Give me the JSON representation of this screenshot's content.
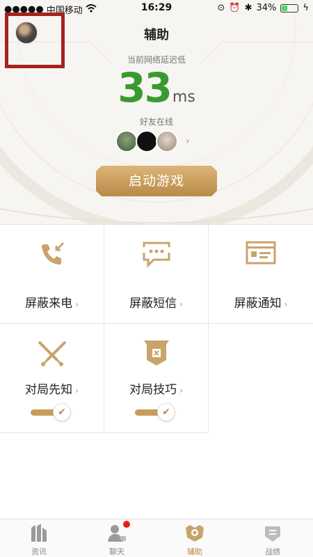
{
  "status_bar": {
    "carrier": "中国移动",
    "time": "16:29",
    "battery": "34%"
  },
  "header": {
    "title": "辅助",
    "latency_label": "当前网络延迟低",
    "latency_value": "33",
    "latency_unit": "ms",
    "friends_label": "好友在线",
    "start_button": "启动游戏"
  },
  "features": [
    {
      "label": "屏蔽来电",
      "icon": "phone-incoming-icon"
    },
    {
      "label": "屏蔽短信",
      "icon": "message-icon"
    },
    {
      "label": "屏蔽通知",
      "icon": "notification-card-icon"
    },
    {
      "label": "对局先知",
      "icon": "crossed-swords-icon",
      "toggle_on": true
    },
    {
      "label": "对局技巧",
      "icon": "banner-icon",
      "toggle_on": true
    }
  ],
  "tabs": [
    {
      "label": "资讯",
      "icon": "news-icon"
    },
    {
      "label": "聊天",
      "icon": "chat-icon"
    },
    {
      "label": "辅助",
      "icon": "assist-icon"
    },
    {
      "label": "战绩",
      "icon": "record-icon"
    }
  ],
  "colors": {
    "accent_gold": "#b98a48",
    "latency_green": "#3a9a2f",
    "highlight_red": "#a8201f"
  }
}
